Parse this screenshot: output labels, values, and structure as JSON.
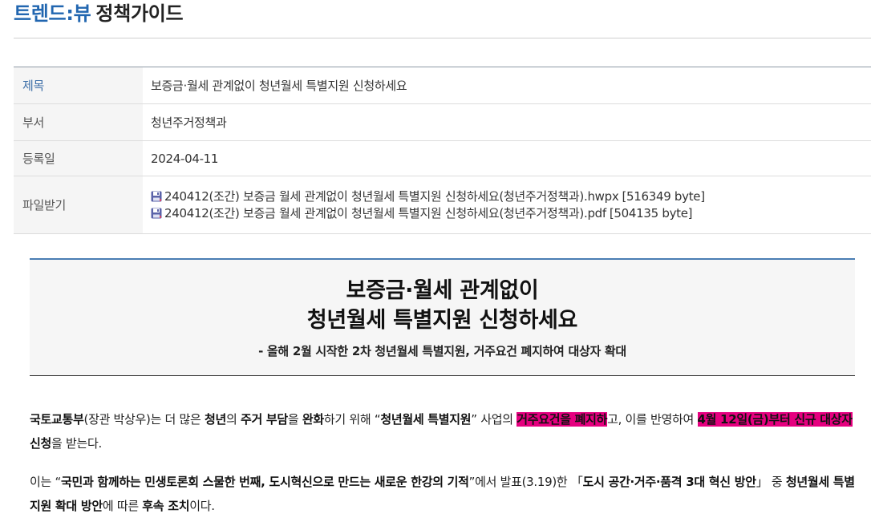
{
  "header": {
    "brand": "트렌드:뷰",
    "section": "정책가이드"
  },
  "info": {
    "title": {
      "label": "제목",
      "value": "보증금·월세 관계없이 청년월세 특별지원 신청하세요"
    },
    "department": {
      "label": "부서",
      "value": "청년주거정책과"
    },
    "date": {
      "label": "등록일",
      "value": "2024-04-11"
    },
    "files": {
      "label": "파일받기",
      "items": [
        {
          "icon": "file-download-icon",
          "name": "240412(조간) 보증금 월세 관계없이 청년월세 특별지원 신청하세요(청년주거정책과).hwpx",
          "size": "[516349 byte]"
        },
        {
          "icon": "file-download-icon",
          "name": "240412(조간) 보증금 월세 관계없이 청년월세 특별지원 신청하세요(청년주거정책과).pdf",
          "size": "[504135 byte]"
        }
      ]
    }
  },
  "article": {
    "title_lines": [
      "보증금·월세 관계없이",
      "청년월세 특별지원 신청하세요"
    ],
    "subtitle": "- 올해 2월 시작한 2차 청년월세 특별지원, 거주요건 폐지하여 대상자 확대",
    "paragraphs": [
      {
        "segments": [
          {
            "text": "국토교통부",
            "bold": true
          },
          {
            "text": "(장관 박상우)는 더 많은 "
          },
          {
            "text": "청년",
            "bold": true
          },
          {
            "text": "의 "
          },
          {
            "text": "주거 부담",
            "bold": true
          },
          {
            "text": "을 "
          },
          {
            "text": "완화",
            "bold": true
          },
          {
            "text": "하기 위해 “"
          },
          {
            "text": "청년월세 특별지원",
            "bold": true
          },
          {
            "text": "” 사업의 "
          },
          {
            "text": "거주요건을 폐지하",
            "bold": true,
            "highlight": true
          },
          {
            "text": "고, 이를 반영하여 "
          },
          {
            "text": "4월 12일(금)부터 신규 대상자",
            "bold": true,
            "highlight": true
          },
          {
            "text": " 신청",
            "bold": true
          },
          {
            "text": "을 받는다."
          }
        ]
      },
      {
        "segments": [
          {
            "text": "이는 “"
          },
          {
            "text": "국민과 함께하는 민생토론회 스물한 번째, 도시혁신으로 만드는 새로운 한강의 기적",
            "bold": true
          },
          {
            "text": "”에서 발표(3.19)한 「"
          },
          {
            "text": "도시 공간·거주·품격 3대 혁신 방안",
            "bold": true
          },
          {
            "text": "」 중 "
          },
          {
            "text": "청년월세 특별지원 확대 방안",
            "bold": true
          },
          {
            "text": "에 따른 "
          },
          {
            "text": "후속 조치",
            "bold": true
          },
          {
            "text": "이다."
          }
        ]
      }
    ]
  },
  "colors": {
    "brand": "#2166b0",
    "highlight": "#e5007f",
    "table_rule": "#8f9aa6",
    "headline_rule": "#4a7db3",
    "label_accent": "#3d6fa8"
  }
}
